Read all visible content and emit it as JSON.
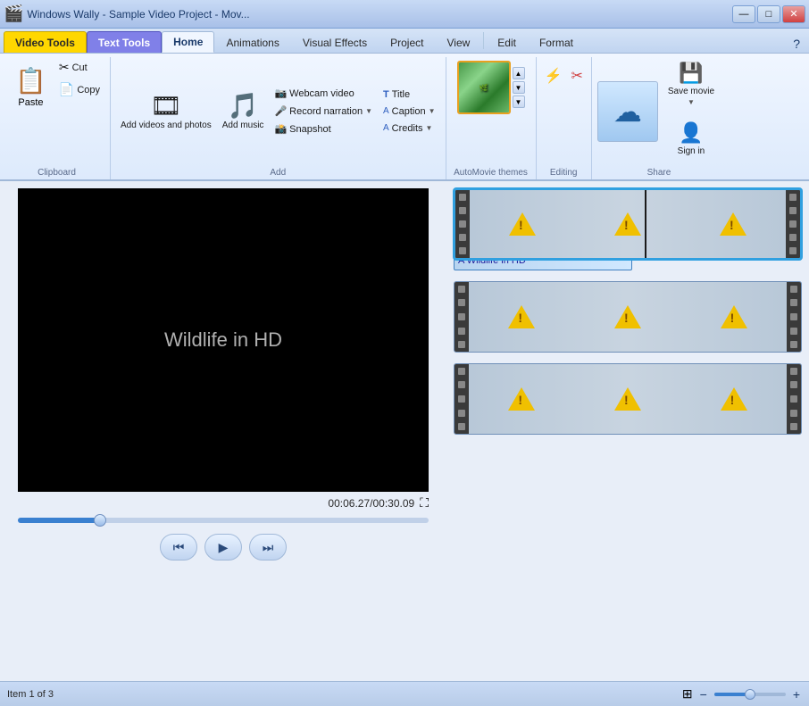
{
  "titleBar": {
    "appIcon": "🎬",
    "title": "Windows Wally - Sample Video Project - Mov...",
    "minimize": "—",
    "maximize": "□",
    "close": "✕"
  },
  "contextTabs": [
    {
      "label": "Video Tools",
      "active": false,
      "context": true
    },
    {
      "label": "Text Tools",
      "active": false,
      "context2": true
    }
  ],
  "ribbonTabs": [
    {
      "label": "Home",
      "active": true
    },
    {
      "label": "Animations",
      "active": false
    },
    {
      "label": "Visual Effects",
      "active": false
    },
    {
      "label": "Project",
      "active": false
    },
    {
      "label": "View",
      "active": false
    },
    {
      "label": "Edit",
      "active": false
    },
    {
      "label": "Format",
      "active": false
    }
  ],
  "clipboard": {
    "pasteLabel": "Paste",
    "cutLabel": "Cut",
    "copyLabel": "Copy"
  },
  "addGroup": {
    "addVideoLabel": "Add videos\nand photos",
    "addMusicLabel": "Add\nmusic",
    "webcamLabel": "Webcam video",
    "recordNarrationLabel": "Record narration",
    "titleLabel": "Title",
    "captionLabel": "Caption",
    "snapshotLabel": "Snapshot",
    "creditsLabel": "Credits"
  },
  "autoMovieLabel": "AutoMovie themes",
  "editingLabel": "Editing",
  "shareGroup": {
    "saveMovieLabel": "Save\nmovie",
    "signInLabel": "Sign\nin"
  },
  "videoPreview": {
    "title": "Wildlife in HD",
    "timeDisplay": "00:06.27/00:30.09"
  },
  "transport": {
    "rewindSymbol": "⏮",
    "playSymbol": "▶",
    "fastForwardSymbol": "⏭"
  },
  "timeline": {
    "strips": [
      {
        "id": 1,
        "selected": true
      },
      {
        "id": 2,
        "selected": false
      },
      {
        "id": 3,
        "selected": false
      }
    ],
    "captionLabel": "A Wildlife in HD"
  },
  "statusBar": {
    "itemCount": "Item 1 of 3"
  },
  "help": "?"
}
